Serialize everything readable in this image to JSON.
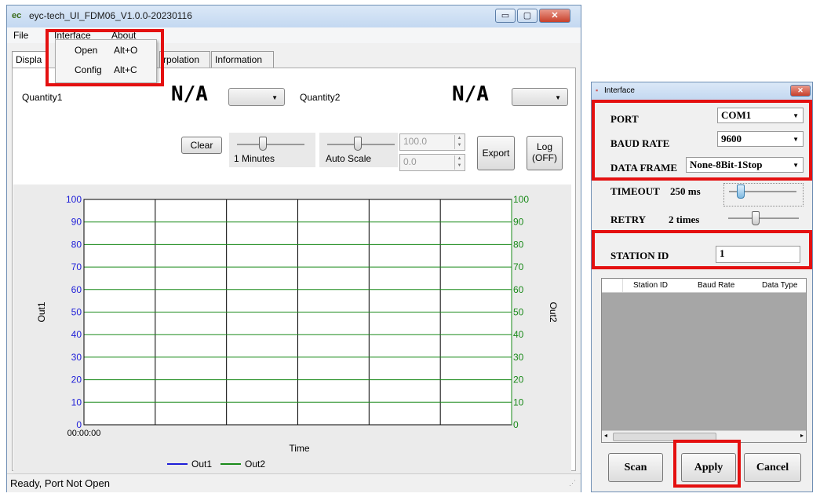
{
  "main_window": {
    "title": "eyc-tech_UI_FDM06_V1.0.0-20230116",
    "app_icon": "ec",
    "controls": {
      "minimize": "▭",
      "maximize": "▢",
      "close": "✕"
    },
    "menu": {
      "file": "File",
      "interface": "Interface",
      "about": "About"
    },
    "tabs": {
      "display": "Displa",
      "interpolation": "rpolation",
      "information": "Information"
    },
    "interface_menu": {
      "open": {
        "label": "Open",
        "shortcut": "Alt+O"
      },
      "config": {
        "label": "Config",
        "shortcut": "Alt+C"
      }
    },
    "quantity1": {
      "label": "Quantity1",
      "value": "N/A"
    },
    "quantity2": {
      "label": "Quantity2",
      "value": "N/A"
    },
    "buttons": {
      "clear": "Clear",
      "export": "Export",
      "log_line1": "Log",
      "log_line2": "(OFF)"
    },
    "time_slider": {
      "label": "1 Minutes"
    },
    "scale_slider": {
      "label": "Auto Scale"
    },
    "scale_max": "100.0",
    "scale_min": "0.0",
    "status": "Ready,   Port Not Open"
  },
  "chart_data": {
    "type": "line",
    "xlabel": "Time",
    "ylabel_left": "Out1",
    "ylabel_right": "Out2",
    "x_tick_labels": [
      "00:00:00"
    ],
    "y_ticks": [
      "0",
      "10",
      "20",
      "30",
      "40",
      "50",
      "60",
      "70",
      "80",
      "90",
      "100"
    ],
    "ylim": [
      0,
      100
    ],
    "grid": true,
    "legend_position": "bottom",
    "series": [
      {
        "name": "Out1",
        "color": "#1e1ed8",
        "values": []
      },
      {
        "name": "Out2",
        "color": "#1a8a1a",
        "values": []
      }
    ]
  },
  "interface_dialog": {
    "title": "Interface",
    "close": "✕",
    "port": {
      "label": "PORT",
      "value": "COM1"
    },
    "baud_rate": {
      "label": "BAUD RATE",
      "value": "9600"
    },
    "data_frame": {
      "label": "DATA FRAME",
      "value": "None-8Bit-1Stop"
    },
    "timeout": {
      "label": "TIMEOUT",
      "value": "250 ms"
    },
    "retry": {
      "label": "RETRY",
      "value": "2 times"
    },
    "station_id": {
      "label": "STATION ID",
      "value": "1"
    },
    "table_headers": [
      "Station ID",
      "Baud Rate",
      "Data Type"
    ],
    "buttons": {
      "scan": "Scan",
      "apply": "Apply",
      "cancel": "Cancel"
    }
  }
}
